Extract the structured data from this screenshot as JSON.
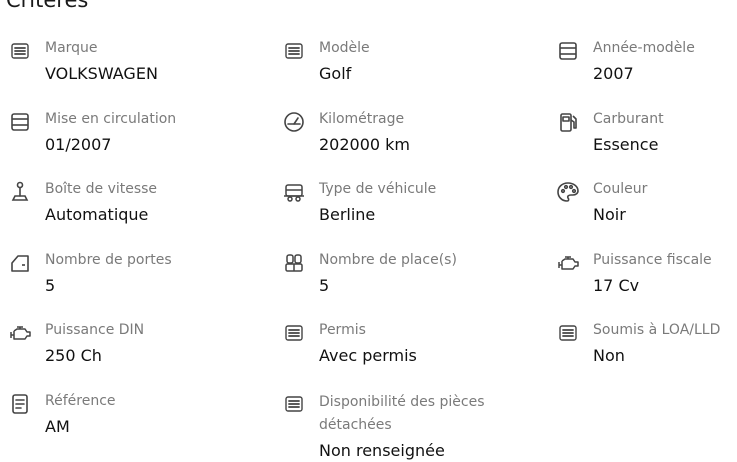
{
  "section": {
    "title": "Critères"
  },
  "criteria": [
    {
      "label": "Marque",
      "value": "VOLKSWAGEN",
      "icon": "list-icon"
    },
    {
      "label": "Modèle",
      "value": "Golf",
      "icon": "list-icon"
    },
    {
      "label": "Année-modèle",
      "value": "2007",
      "icon": "calendar-icon"
    },
    {
      "label": "Mise en circulation",
      "value": "01/2007",
      "icon": "calendar-icon"
    },
    {
      "label": "Kilométrage",
      "value": "202000 km",
      "icon": "speedometer-icon"
    },
    {
      "label": "Carburant",
      "value": "Essence",
      "icon": "fuel-pump-icon"
    },
    {
      "label": "Boîte de vitesse",
      "value": "Automatique",
      "icon": "gear-stick-icon"
    },
    {
      "label": "Type de véhicule",
      "value": "Berline",
      "icon": "vehicle-type-icon"
    },
    {
      "label": "Couleur",
      "value": "Noir",
      "icon": "palette-icon"
    },
    {
      "label": "Nombre de portes",
      "value": "5",
      "icon": "car-door-icon"
    },
    {
      "label": "Nombre de place(s)",
      "value": "5",
      "icon": "car-seat-icon"
    },
    {
      "label": "Puissance fiscale",
      "value": "17 Cv",
      "icon": "engine-icon"
    },
    {
      "label": "Puissance DIN",
      "value": "250 Ch",
      "icon": "engine-icon"
    },
    {
      "label": "Permis",
      "value": "Avec permis",
      "icon": "list-icon"
    },
    {
      "label": "Soumis à LOA/LLD",
      "value": "Non",
      "icon": "list-icon"
    },
    {
      "label": "Référence",
      "value": "AM",
      "icon": "document-icon"
    },
    {
      "label": "Disponibilité des pièces détachées",
      "value": "Non renseignée",
      "icon": "list-icon"
    }
  ],
  "colors": {
    "label": "#7a7a7a",
    "value": "#111111",
    "icon": "#444444"
  }
}
